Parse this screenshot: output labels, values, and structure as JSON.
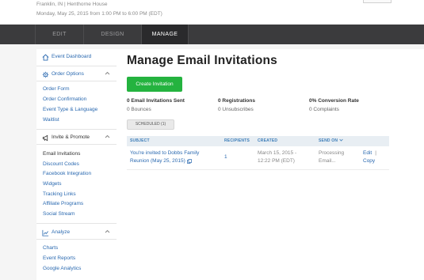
{
  "event": {
    "location": "Franklin, IN | Henthorne House",
    "datetime": "Monday, May 25, 2015 from 1:00 PM to 6:00 PM (EDT)"
  },
  "nav": {
    "tabs": [
      {
        "label": "EDIT",
        "active": false
      },
      {
        "label": "DESIGN",
        "active": false
      },
      {
        "label": "MANAGE",
        "active": true
      }
    ]
  },
  "sidebar": {
    "dashboard": "Event Dashboard",
    "order_options": {
      "title": "Order Options",
      "items": [
        "Order Form",
        "Order Confirmation",
        "Event Type & Language",
        "Waitlist"
      ]
    },
    "invite_promote": {
      "title": "Invite & Promote",
      "items": [
        "Email Invitations",
        "Discount Codes",
        "Facebook Integration",
        "Widgets",
        "Tracking Links",
        "Affiliate Programs",
        "Social Stream"
      ]
    },
    "analyze": {
      "title": "Analyze",
      "items": [
        "Charts",
        "Event Reports",
        "Google Analytics"
      ]
    }
  },
  "main": {
    "title": "Manage Email Invitations",
    "create_button": "Create Invitation",
    "stats": [
      {
        "value": "0 Email Invitations Sent",
        "sub": "0 Bounces"
      },
      {
        "value": "0 Registrations",
        "sub": "0 Unsubscribes"
      },
      {
        "value": "0% Conversion Rate",
        "sub": "0 Complaints"
      }
    ],
    "tab": "SCHEDULED (1)",
    "table": {
      "headers": {
        "subject": "SUBJECT",
        "recipients": "RECIPIENTS",
        "created": "CREATED",
        "send_on": "SEND ON"
      },
      "rows": [
        {
          "subject_line1": "You're invited to Dobbs Family",
          "subject_line2": "Reunion (May 25, 2015)",
          "recipients": "1",
          "created_line1": "March 15, 2015 -",
          "created_line2": "12:22 PM (EDT)",
          "send_on_line1": "Processing",
          "send_on_line2": "Email...",
          "edit": "Edit",
          "separator": "|",
          "copy": "Copy"
        }
      ]
    }
  },
  "colors": {
    "accent_green": "#24b33f",
    "link_blue": "#2a69b0",
    "nav_bg": "#3b3b3d"
  }
}
